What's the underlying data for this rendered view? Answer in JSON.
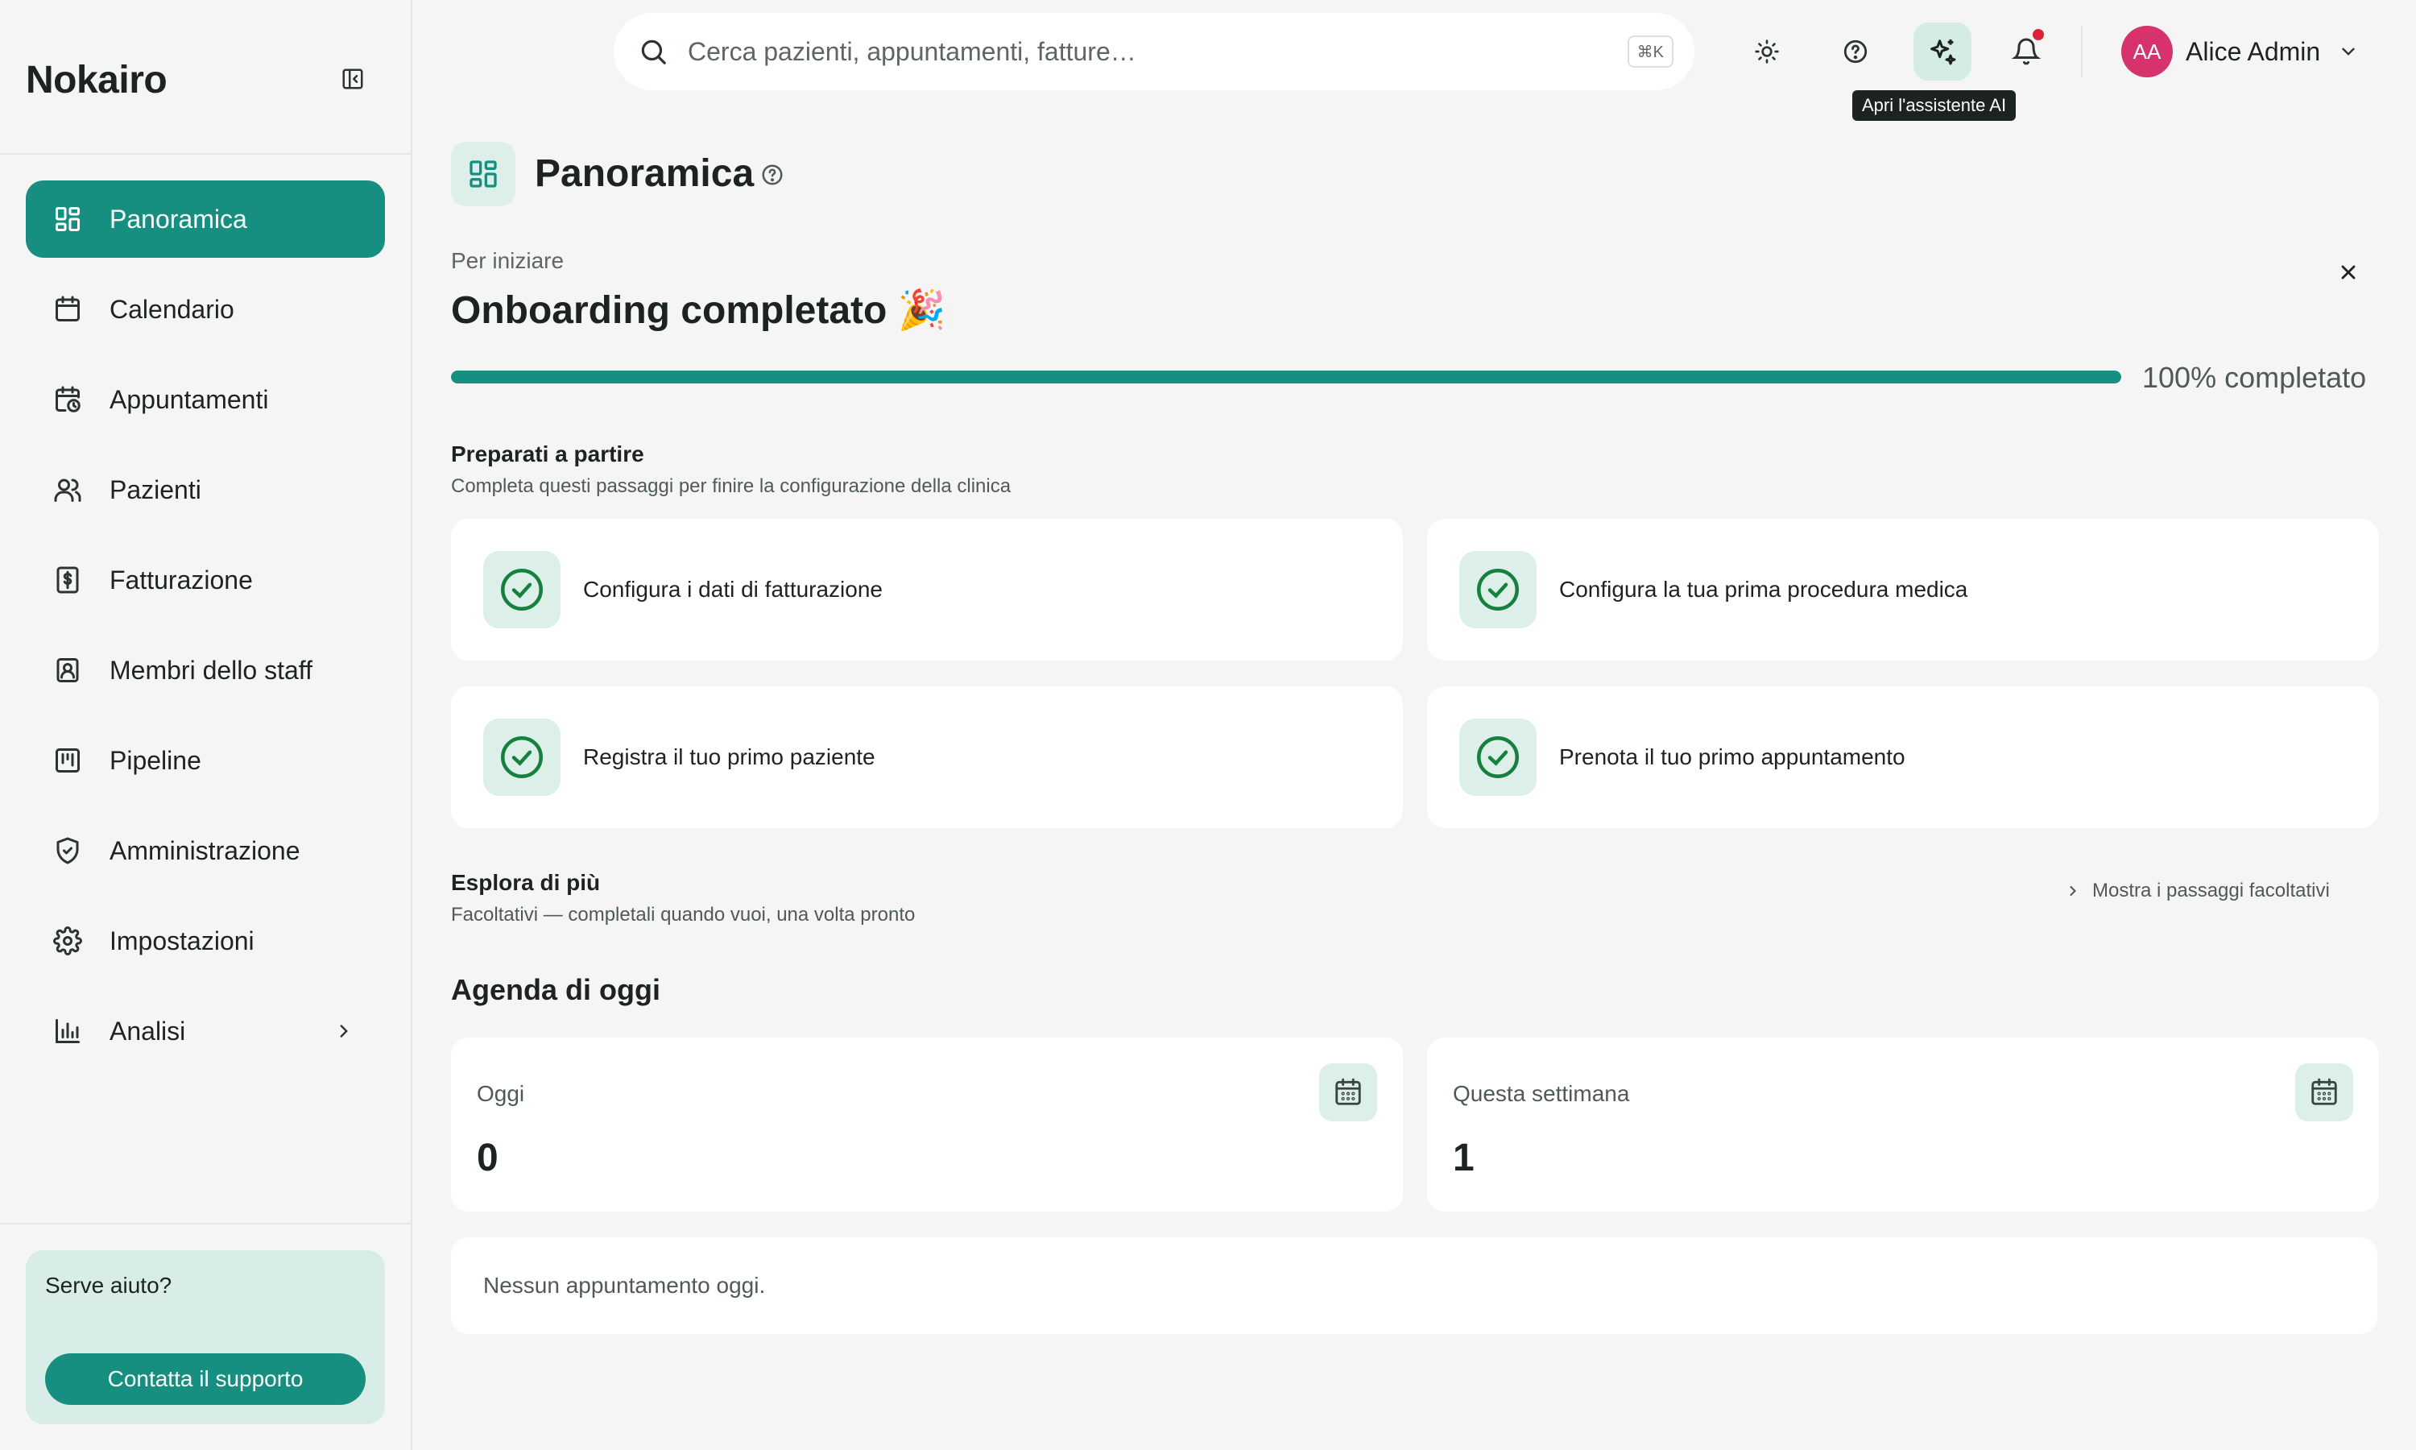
{
  "app": {
    "brand": "Nokairo"
  },
  "sidebar": {
    "items": [
      {
        "label": "Panoramica",
        "icon": "dashboard-icon",
        "active": true
      },
      {
        "label": "Calendario",
        "icon": "calendar-icon"
      },
      {
        "label": "Appuntamenti",
        "icon": "calendar-clock-icon"
      },
      {
        "label": "Pazienti",
        "icon": "users-icon"
      },
      {
        "label": "Fatturazione",
        "icon": "invoice-icon"
      },
      {
        "label": "Membri dello staff",
        "icon": "staff-badge-icon"
      },
      {
        "label": "Pipeline",
        "icon": "kanban-icon"
      },
      {
        "label": "Amministrazione",
        "icon": "shield-icon"
      },
      {
        "label": "Impostazioni",
        "icon": "gear-icon"
      },
      {
        "label": "Analisi",
        "icon": "bar-chart-icon",
        "has_submenu": true
      }
    ],
    "help": {
      "title": "Serve aiuto?",
      "button": "Contatta il supporto"
    }
  },
  "topbar": {
    "search_placeholder": "Cerca pazienti, appuntamenti, fatture…",
    "search_shortcut": "⌘K",
    "ai_tooltip": "Apri l'assistente AI",
    "user": {
      "initials": "AA",
      "name": "Alice Admin"
    }
  },
  "page": {
    "title": "Panoramica",
    "onboarding": {
      "eyebrow": "Per iniziare",
      "title": "Onboarding completato",
      "emoji": "🎉",
      "progress": 1.0,
      "progress_label": "100% completato",
      "section_title": "Preparati a partire",
      "section_subtitle": "Completa questi passaggi per finire la configurazione della clinica",
      "tasks": [
        {
          "label": "Configura i dati di fatturazione",
          "done": true
        },
        {
          "label": "Configura la tua prima procedura medica",
          "done": true
        },
        {
          "label": "Registra il tuo primo paziente",
          "done": true
        },
        {
          "label": "Prenota il tuo primo appuntamento",
          "done": true
        }
      ]
    },
    "explore": {
      "title": "Esplora di più",
      "subtitle": "Facoltativi — completali quando vuoi, una volta pronto",
      "toggle": "Mostra i passaggi facoltativi"
    },
    "agenda": {
      "title": "Agenda di oggi",
      "stats": [
        {
          "label": "Oggi",
          "value": "0"
        },
        {
          "label": "Questa settimana",
          "value": "1"
        }
      ],
      "empty": "Nessun appuntamento oggi."
    }
  },
  "colors": {
    "accent": "#168f80",
    "accent_soft": "#dcefe9",
    "notification": "#e0203a",
    "avatar": "#d6336c"
  }
}
